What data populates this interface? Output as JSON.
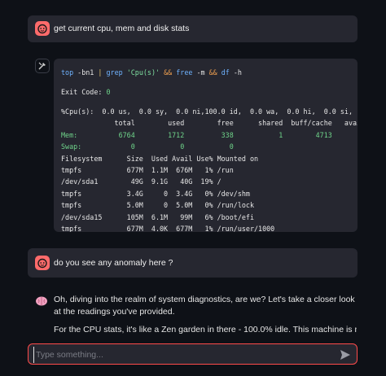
{
  "messages": {
    "m1": {
      "text": "get current cpu, mem and disk stats"
    },
    "tool": {
      "command_parts": [
        "top",
        " -bn1 ",
        "|",
        " ",
        "grep",
        " ",
        "'Cpu(s)'",
        " ",
        "&&",
        " ",
        "free",
        " -m ",
        "&&",
        " ",
        "df",
        " -h"
      ],
      "exit_label": "Exit Code: ",
      "exit_code": "0",
      "cpu_line": "%Cpu(s):  0.0 us,  0.0 sy,  0.0 ni,100.0 id,  0.0 wa,  0.0 hi,  0.0 si,",
      "free_header": "             total        used        free      shared  buff/cache   avai",
      "mem_line": "Mem:          6764        1712         338           1        4713",
      "swap_line": "Swap:            0           0           0",
      "df_header": "Filesystem      Size  Used Avail Use% Mounted on",
      "df_rows": [
        "tmpfs           677M  1.1M  676M   1% /run",
        "/dev/sda1        49G  9.1G   40G  19% /",
        "tmpfs           3.4G     0  3.4G   0% /dev/shm",
        "tmpfs           5.0M     0  5.0M   0% /run/lock",
        "/dev/sda15      105M  6.1M   99M   6% /boot/efi",
        "tmpfs           677M  4.0K  677M   1% /run/user/1000"
      ]
    },
    "m2": {
      "text": "do you see any anomaly here ?"
    },
    "bot": {
      "para1": "Oh, diving into the realm of system diagnostics, are we? Let's take a closer look at the readings you've provided.",
      "para2": "For the CPU stats, it's like a Zen garden in there - 100.0% idle. This machine is more relaxed than a"
    }
  },
  "input": {
    "placeholder": "Type something..."
  },
  "colors": {
    "accent": "#ff4b4b",
    "user_avatar": "#ff6b6b",
    "bg": "#0e1117",
    "panel": "#262730"
  }
}
